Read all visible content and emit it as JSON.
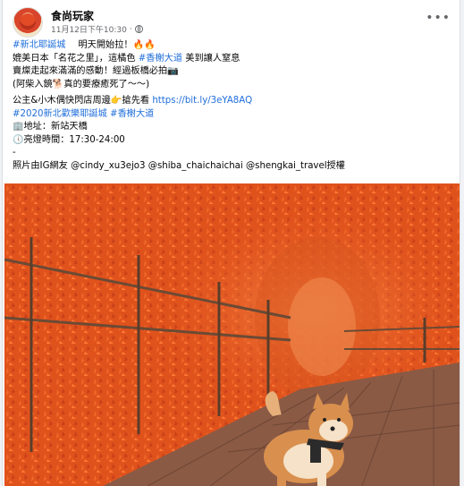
{
  "post": {
    "page_name": "食尚玩家",
    "timestamp": "11月12日下午10:30",
    "separator": "·",
    "lines": [
      {
        "hashtag": "#新北耶誕城",
        "text_after": "明天開始拉！🔥🔥"
      },
      {
        "text_before": "媲美日本「名花之里」，這橘色 ",
        "hashtag": "#香榭大道",
        "text_after": " 美到讓人窒息"
      },
      {
        "text": "賣燦走起來滿滿的感動！經過板橋必拍📷"
      },
      {
        "text": "(阿柴入鏡🐕真的要療癒死了～～)"
      }
    ],
    "promo_text": "公主&小木偶快閃店周邊👉搶先看 ",
    "promo_link": "https://bit.ly/3eYA8AQ",
    "tags_line": {
      "tag1": "#2020新北歡樂耶誕城",
      "tag2": "#香榭大道"
    },
    "address_icon": "🏢",
    "address_text": "地址：新站天橋",
    "hours_icon": "🕔",
    "hours_text": "亮燈時間：17:30-24:00",
    "dash": "-",
    "credits": "照片由IG網友 @cindy_xu3ejo3 @shiba_chaichaichai @shengkai_travel授權"
  },
  "icons": {
    "globe": "globe-icon",
    "more": "more-options-icon"
  },
  "colors": {
    "link": "#216fdb",
    "text": "#050505",
    "meta": "#65676b",
    "maple": "#e8541f"
  }
}
